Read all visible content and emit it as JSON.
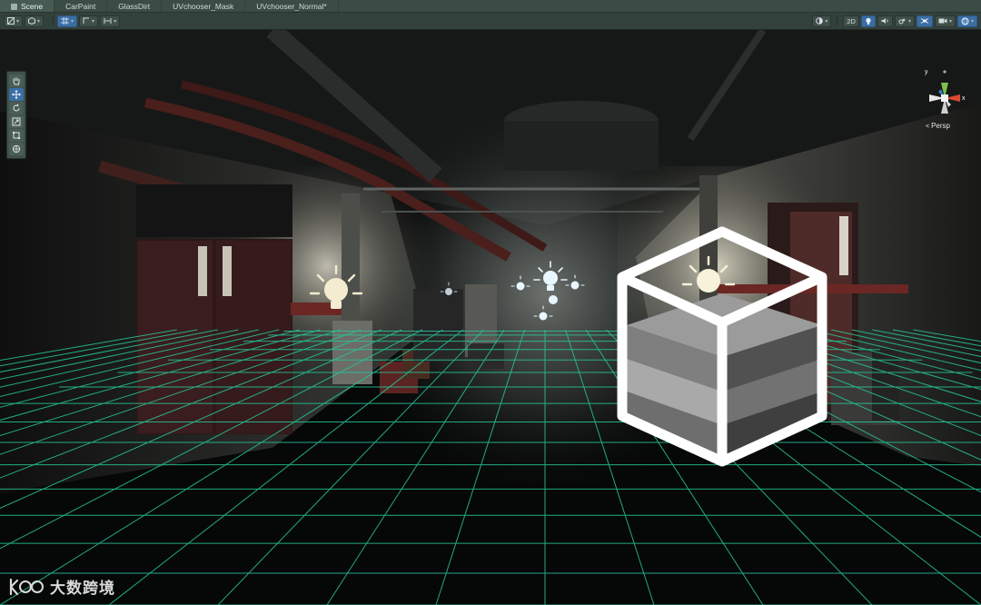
{
  "tabs": [
    {
      "label": "Scene",
      "active": true
    },
    {
      "label": "CarPaint",
      "active": false
    },
    {
      "label": "GlassDirt",
      "active": false
    },
    {
      "label": "UVchooser_Mask",
      "active": false
    },
    {
      "label": "UVchooser_Normal*",
      "active": false
    }
  ],
  "toolbar": {
    "mode_2d_label": "2D"
  },
  "tools": [
    "view-tool",
    "move-tool",
    "rotate-tool",
    "scale-tool",
    "rect-tool",
    "transform-tool"
  ],
  "gizmo": {
    "y_label": "y",
    "x_label": "x",
    "projection_label": "Persp",
    "x_color": "#d84a32",
    "y_color": "#7cc24a",
    "z_color": "#3b7bd6"
  },
  "watermark": {
    "text": "大数跨境"
  },
  "colors": {
    "grid": "#27c79a",
    "light_icon": "#e8f6ff",
    "tab_bg": "#3b4b45",
    "accent": "#3a6ea3"
  }
}
